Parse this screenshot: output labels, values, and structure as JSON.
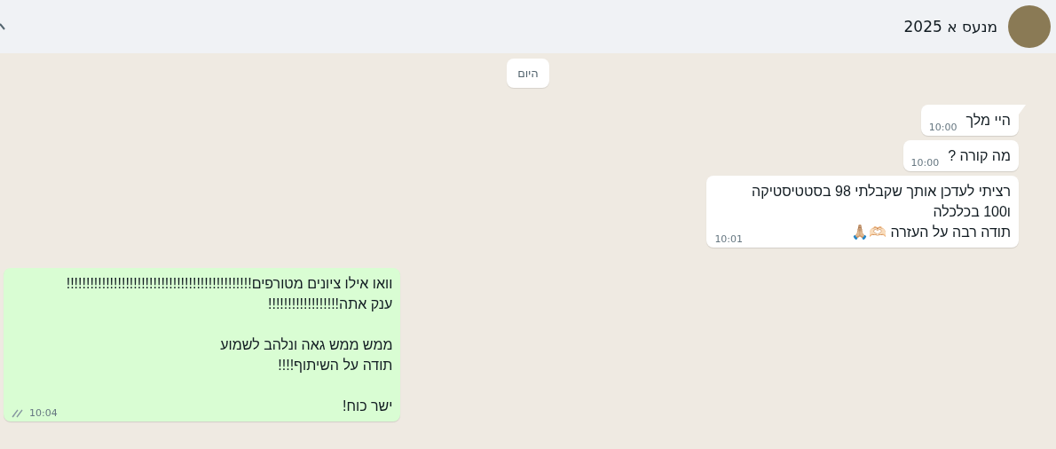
{
  "header": {
    "title": "מנעס א 2025"
  },
  "date_chip": "היום",
  "messages": [
    {
      "kind": "in",
      "tail": true,
      "paragraphs": [
        [
          "היי מלך"
        ]
      ],
      "time": "10:00"
    },
    {
      "kind": "in",
      "tail": false,
      "paragraphs": [
        [
          "מה קורה ?"
        ]
      ],
      "time": "10:00"
    },
    {
      "kind": "in",
      "tail": false,
      "paragraphs": [
        [
          "רציתי לעדכן אותך שקבלתי 98 בסטטיסטיקה",
          "ו100 בכלכלה",
          "תודה רבה על העזרה 🫶🏻🙏🏼"
        ]
      ],
      "time": "10:01"
    },
    {
      "kind": "out",
      "tail": false,
      "paragraphs": [
        [
          "וואו אילו ציונים מטורפים!!!!!!!!!!!!!!!!!!!!!!!!!!!!!!!!!!!!!!!!!!!!!!!",
          "ענק אתה!!!!!!!!!!!!!!!!!!"
        ],
        [
          "ממש ממש גאה ונלהב לשמוע",
          "תודה על השיתוף!!!!"
        ],
        [
          "ישר כוח!"
        ]
      ],
      "time": "10:04",
      "read": false
    }
  ]
}
